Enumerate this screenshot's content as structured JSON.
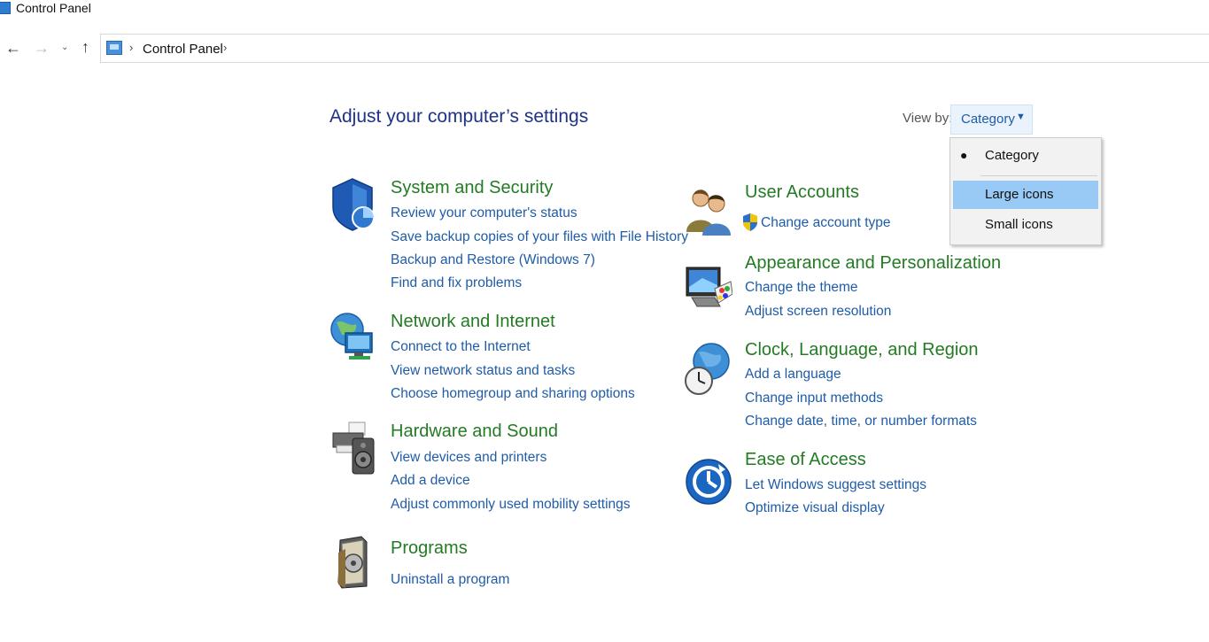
{
  "window": {
    "title": "Control Panel"
  },
  "address": {
    "crumb": "Control Panel",
    "sep": "›"
  },
  "nav": {
    "back": "←",
    "forward": "→",
    "recent": "⌄",
    "up": "↑"
  },
  "header": {
    "title": "Adjust your computer’s settings"
  },
  "view_by": {
    "label": "View by:",
    "selected": "Category",
    "arrow": "▼",
    "options": [
      "Category",
      "Large icons",
      "Small icons"
    ],
    "bullet": "●"
  },
  "categories": {
    "system_security": {
      "title": "System and Security",
      "links": [
        "Review your computer's status",
        "Save backup copies of your files with File History",
        "Backup and Restore (Windows 7)",
        "Find and fix problems"
      ]
    },
    "network": {
      "title": "Network and Internet",
      "links": [
        "Connect to the Internet",
        "View network status and tasks",
        "Choose homegroup and sharing options"
      ]
    },
    "hardware": {
      "title": "Hardware and Sound",
      "links": [
        "View devices and printers",
        "Add a device",
        "Adjust commonly used mobility settings"
      ]
    },
    "programs": {
      "title": "Programs",
      "links": [
        "Uninstall a program"
      ]
    },
    "user_accounts": {
      "title": "User Accounts",
      "links": [
        "Change account type"
      ]
    },
    "appearance": {
      "title": "Appearance and Personalization",
      "links": [
        "Change the theme",
        "Adjust screen resolution"
      ]
    },
    "clock": {
      "title": "Clock, Language, and Region",
      "links": [
        "Add a language",
        "Change input methods",
        "Change date, time, or number formats"
      ]
    },
    "ease": {
      "title": "Ease of Access",
      "links": [
        "Let Windows suggest settings",
        "Optimize visual display"
      ]
    }
  },
  "colors": {
    "category_title": "#237b24",
    "link": "#1f5ca8",
    "heading": "#1e3287",
    "menu_highlight": "#99c9f5"
  }
}
